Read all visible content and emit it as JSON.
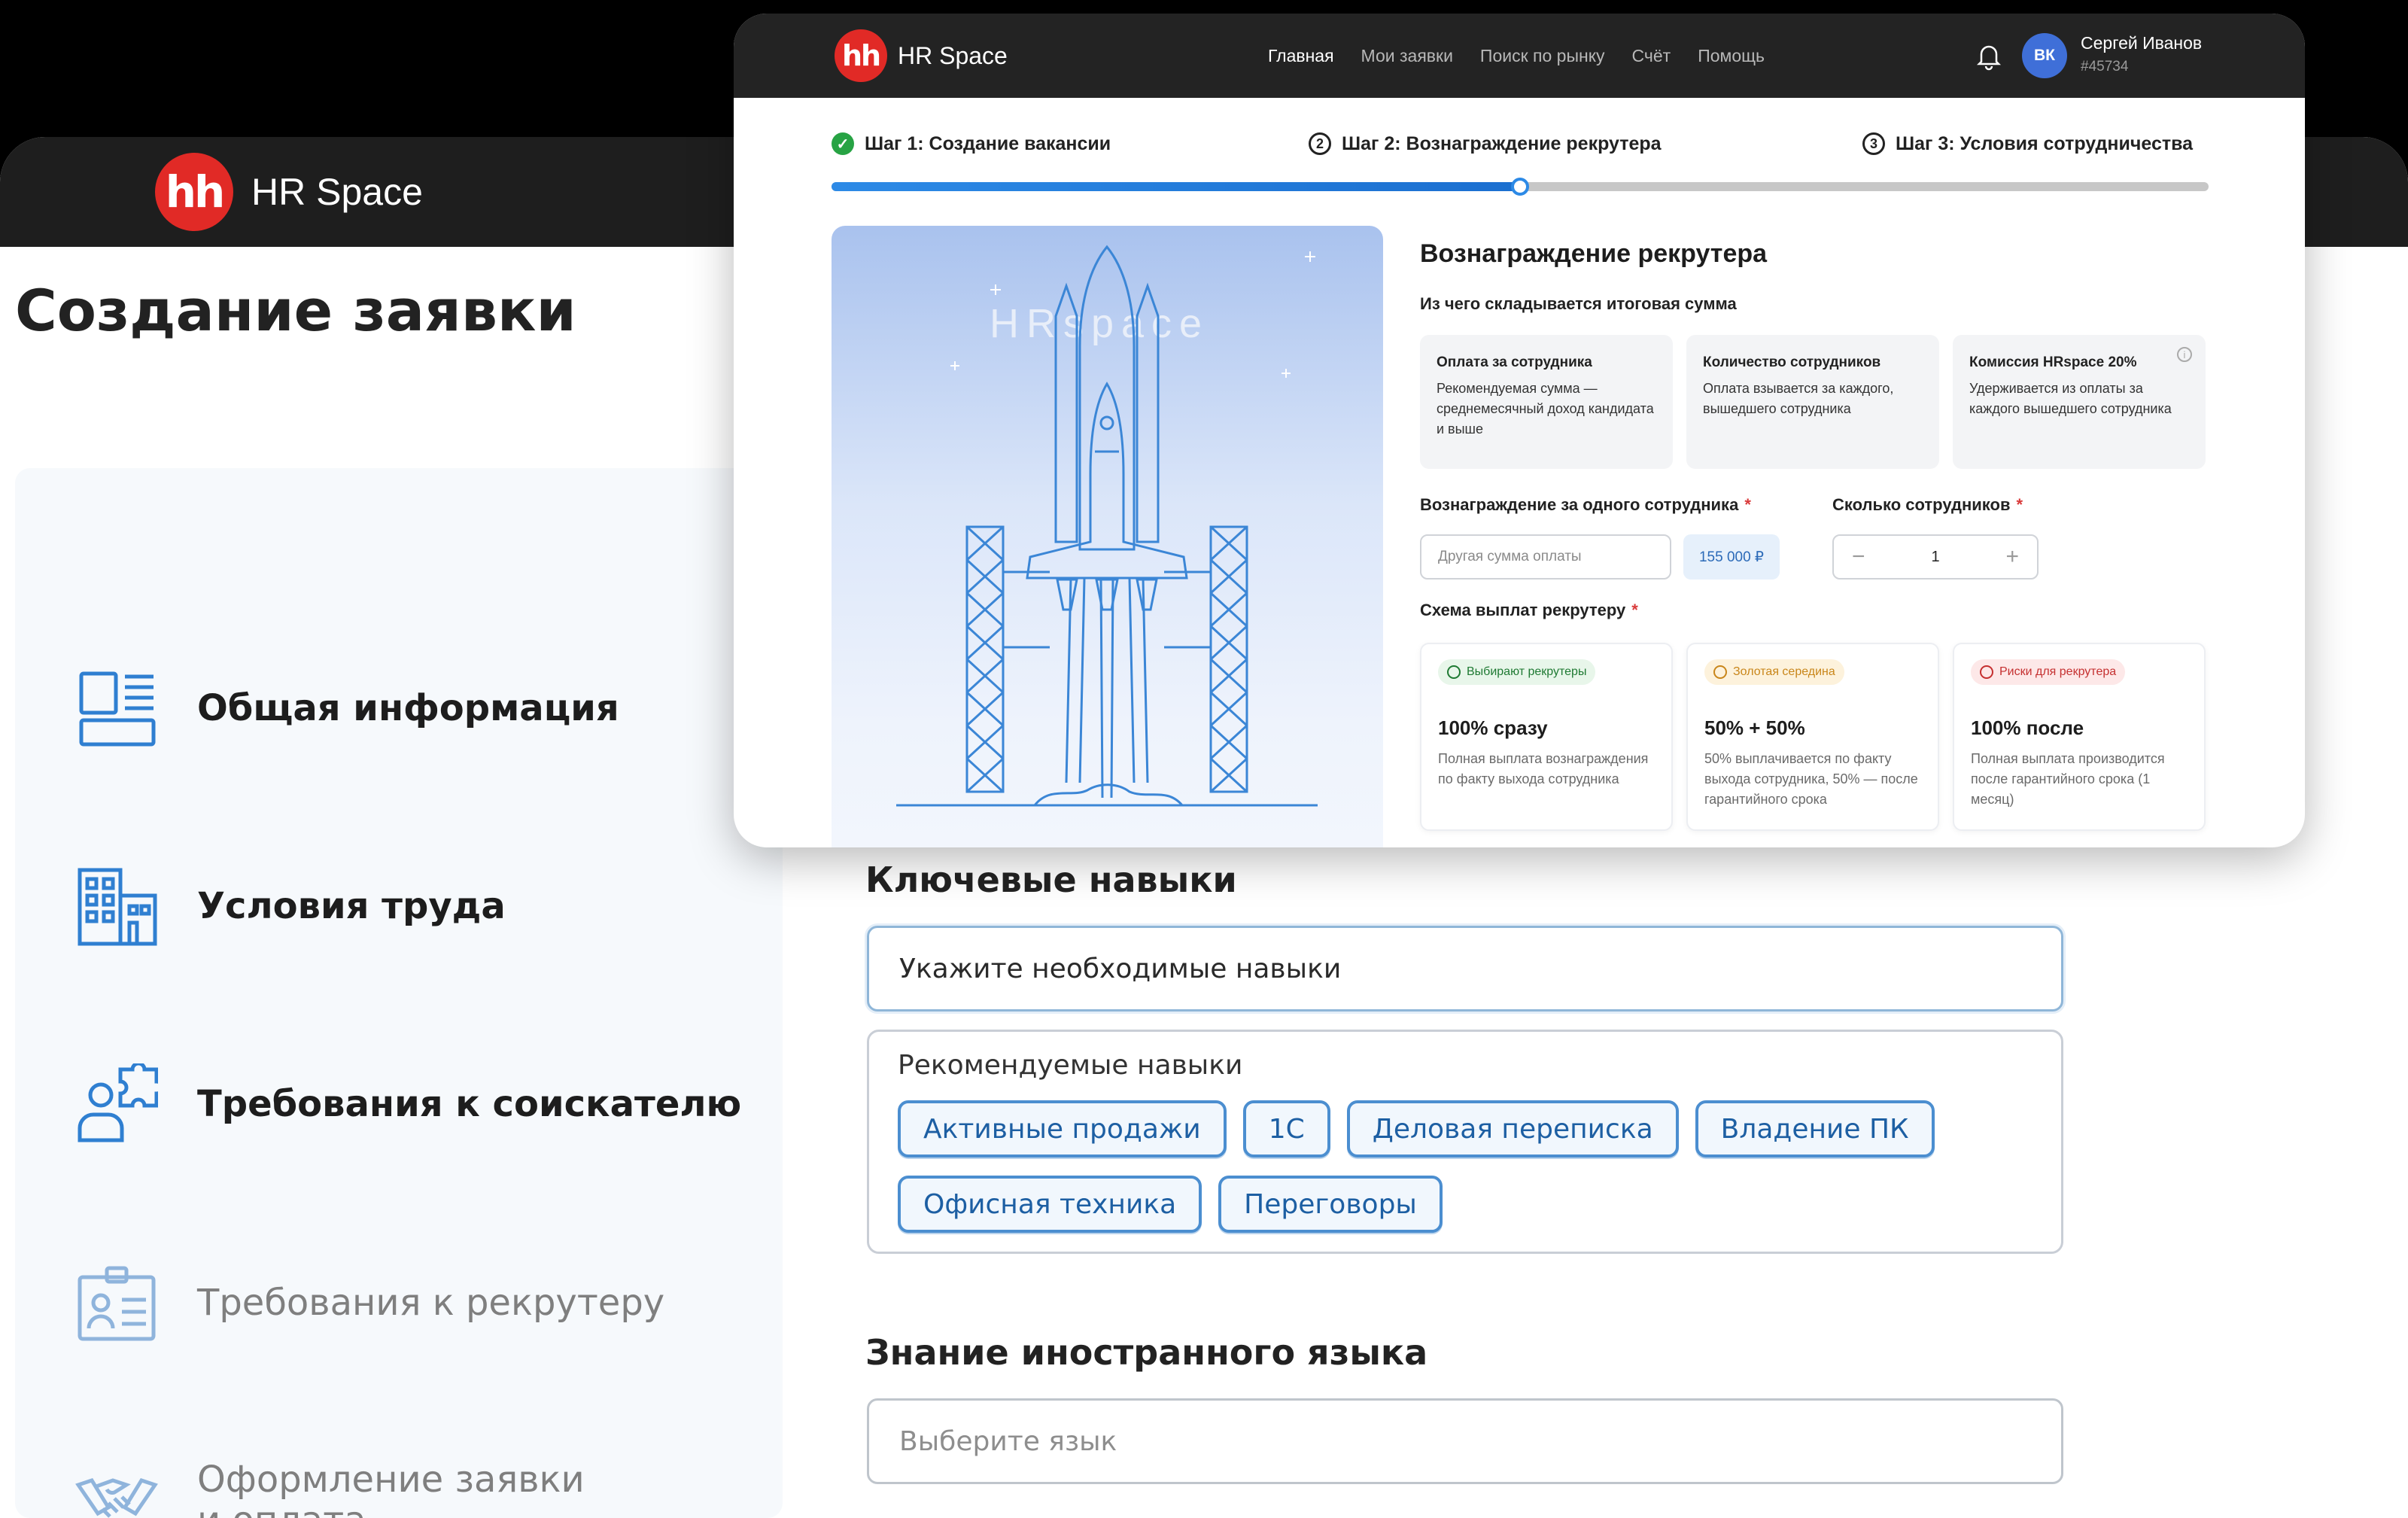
{
  "back": {
    "brand": "HR Space",
    "logo": "hh",
    "page_title": "Создание заявки",
    "nav": [
      {
        "label": "Общая информация"
      },
      {
        "label": "Условия труда"
      },
      {
        "label": "Требования к соискателю"
      },
      {
        "label": "Требования к рекрутеру"
      },
      {
        "label": "Оформление заявки\nи оплата"
      }
    ],
    "skills": {
      "title": "Ключевые навыки",
      "placeholder": "Укажите необходимые навыки",
      "recommended_title": "Рекомендуемые навыки",
      "chips": [
        "Активные продажи",
        "1С",
        "Деловая переписка",
        "Владение ПК",
        "Офисная техника",
        "Переговоры"
      ]
    },
    "language": {
      "title": "Знание иностранного языка",
      "placeholder": "Выберите язык"
    }
  },
  "front": {
    "brand": "HR Space",
    "logo": "hh",
    "menu": [
      "Главная",
      "Мои заявки",
      "Поиск по рынку",
      "Счёт",
      "Помощь"
    ],
    "user": {
      "initials": "ВК",
      "name": "Сергей Иванов",
      "id": "#45734"
    },
    "steps": [
      {
        "num": "✓",
        "label": "Шаг 1: Создание вакансии"
      },
      {
        "num": "2",
        "label": "Шаг 2: Вознаграждение рекрутера"
      },
      {
        "num": "3",
        "label": "Шаг 3: Условия сотрудничества"
      }
    ],
    "progress": 0.5,
    "illustration_text": "HRspace",
    "form": {
      "title": "Вознаграждение рекрутера",
      "subtitle": "Из чего складывается итоговая сумма",
      "cards": [
        {
          "title": "Оплата за сотрудника",
          "desc": "Рекомендуемая сумма — среднемесячный доход кандидата и выше"
        },
        {
          "title": "Количество сотрудников",
          "desc": "Оплата взывается за каждого, вышедшего сотрудника"
        },
        {
          "title": "Комиссия HRspace 20%",
          "desc": "Удерживается из оплаты за каждого вышедшего сотрудника",
          "info": "i"
        }
      ],
      "reward_label": "Вознаграждение за одного сотрудника",
      "count_label": "Сколько сотрудников",
      "required_mark": "*",
      "amount_placeholder": "Другая сумма оплаты",
      "amount_suggestion": "155 000 ₽",
      "count_value": "1",
      "minus": "−",
      "plus": "+",
      "scheme_label": "Схема выплат рекрутеру",
      "schemes": [
        {
          "tag": "Выбирают рекрутеры",
          "value": "100% сразу",
          "desc": "Полная выплата вознаграждения по факту выхода сотрудника"
        },
        {
          "tag": "Золотая середина",
          "value": "50% + 50%",
          "desc": "50% выплачивается по факту выхода сотрудника, 50% — после гарантийного срока"
        },
        {
          "tag": "Риски для рекрутера",
          "value": "100% после",
          "desc": "Полная выплата производится после гарантийного срока (1 месяц)"
        }
      ]
    }
  },
  "colors": {
    "brand_red": "#e12a26",
    "accent_blue": "#2d8ae6",
    "success_green": "#27a344"
  }
}
